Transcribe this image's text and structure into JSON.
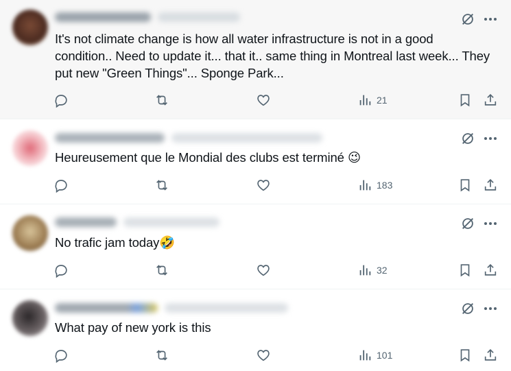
{
  "posts": [
    {
      "text": "It's not climate change is how all water infrastructure is not in a good condition.. Need to update it... that it.. same thing in Montreal last week... They put new \"Green Things\"... Sponge Park...",
      "views": "21",
      "avatar_color": "#5a3b2e"
    },
    {
      "text": "Heureusement que le Mondial des clubs est terminé 😉",
      "views": "183",
      "avatar_color": "#e8b4b8"
    },
    {
      "text": "No trafic jam today🤣",
      "views": "32",
      "avatar_color": "#b59a6a"
    },
    {
      "text": "What pay of new york is this",
      "views": "101",
      "avatar_color": "#5d5658"
    }
  ],
  "colors": {
    "icon_gray": "#536471",
    "text": "#0f1419",
    "divider": "#eff3f4",
    "hover_bg": "#f7f7f7"
  },
  "icons": [
    "grok-icon",
    "more-icon",
    "reply-icon",
    "repost-icon",
    "like-icon",
    "views-icon",
    "bookmark-icon",
    "share-icon"
  ]
}
